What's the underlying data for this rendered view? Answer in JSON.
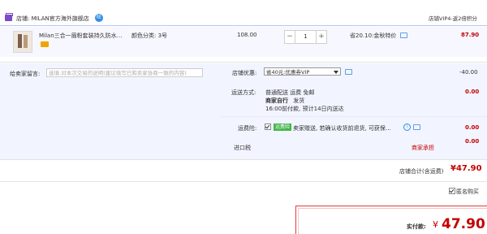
{
  "header": {
    "right_text": "店铺VIP4-返2倍积分"
  },
  "store": {
    "label": "店铺: MILAN官方海外旗舰店",
    "badge": "旺"
  },
  "item": {
    "title": "Milan三合一眉粉套装持久防水…",
    "option": "颜色分类: 3号",
    "unit_price": "108.00",
    "quantity": "1",
    "minus": "−",
    "plus": "+",
    "promo": "省20.10:金秋特价",
    "subtotal": "87.90"
  },
  "message": {
    "label": "给卖家留言:",
    "placeholder": "选填:对本次交易的说明(建议填写已和卖家协商一致的内容)"
  },
  "discount": {
    "label": "店铺优惠:",
    "selected": "省40元:优惠券VIP",
    "amount": "-40.00"
  },
  "shipping": {
    "label": "运送方式:",
    "line1": "普通配送 运费 免邮",
    "line2_strong": "商家自行",
    "line2_rest": "发货",
    "line3": "16:00前付款, 预计14日内送达",
    "amount": "0.00"
  },
  "insurance": {
    "label": "运费险:",
    "tag": "运费险",
    "text": "卖家赠送, 若确认收货前退货, 可获保…",
    "amount": "0.00"
  },
  "import_tax": {
    "label": "进口税",
    "note": "商家承担",
    "amount": "0.00"
  },
  "store_total": {
    "label": "店铺合计(含运费)",
    "amount": "¥47.90"
  },
  "anonymous": {
    "label": "匿名购买"
  },
  "pay": {
    "label": "实付款:",
    "currency": "¥",
    "amount": "47.90"
  },
  "colors": {
    "accent_red": "#c40000",
    "link_blue": "#2e8de6",
    "store_purple": "#7b49c9"
  }
}
